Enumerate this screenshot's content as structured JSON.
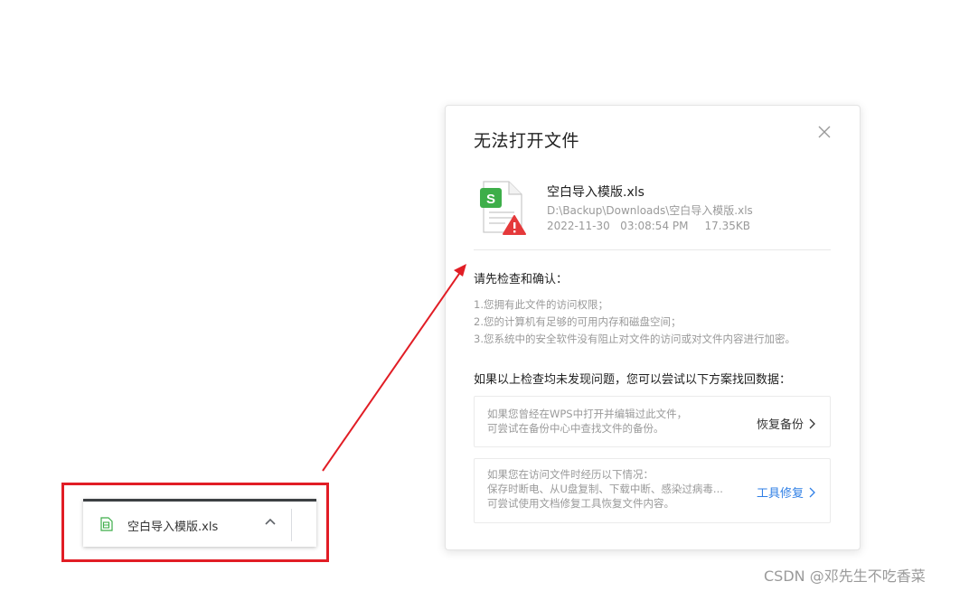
{
  "dialog": {
    "title": "无法打开文件",
    "file": {
      "name": "空白导入模版.xls",
      "path": "D:\\Backup\\Downloads\\空白导入模版.xls",
      "datetime": "2022-11-30   03:08:54 PM",
      "size": "17.35KB",
      "badge_letter": "S"
    },
    "check_heading": "请先检查和确认：",
    "check_items": [
      "1.您拥有此文件的访问权限；",
      "2.您的计算机有足够的可用内存和磁盘空间；",
      "3.您系统中的安全软件没有阻止对文件的访问或对文件内容进行加密。"
    ],
    "recover_heading": "如果以上检查均未发现问题，您可以尝试以下方案找回数据：",
    "options": [
      {
        "lines": [
          "如果您曾经在WPS中打开并编辑过此文件，",
          "可尝试在备份中心中查找文件的备份。"
        ],
        "action": "恢复备份"
      },
      {
        "lines": [
          "如果您在访问文件时经历以下情况：",
          "保存时断电、从U盘复制、下载中断、感染过病毒...",
          "可尝试使用文档修复工具恢复文件内容。"
        ],
        "action": "工具修复"
      }
    ]
  },
  "download_bar": {
    "file_name": "空白导入模版.xls"
  },
  "watermark": "CSDN @邓先生不吃香菜",
  "colors": {
    "accent_blue": "#2f7fe6",
    "annotation_red": "#e11d25",
    "wps_green": "#3dae49",
    "warning_red": "#e5393b"
  },
  "icons": {
    "close": "close-icon",
    "file": "spreadsheet-file-icon",
    "warning": "warning-icon",
    "chevron_right": "chevron-right-icon",
    "chevron_up": "chevron-up-icon"
  }
}
